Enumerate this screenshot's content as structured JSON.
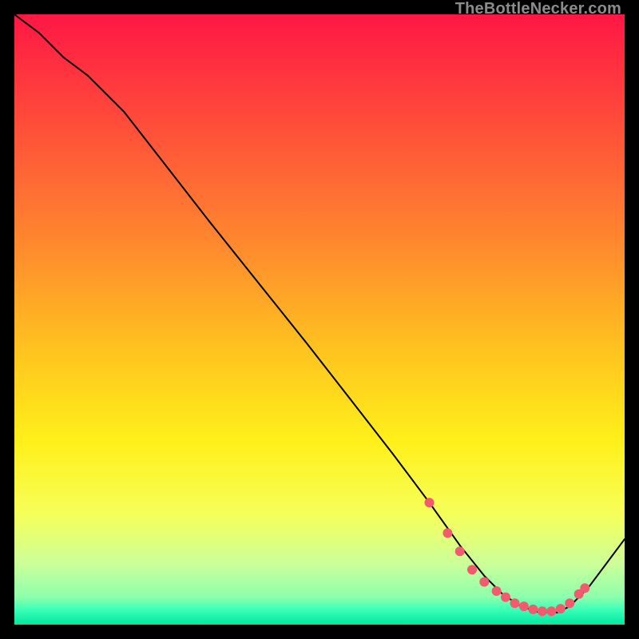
{
  "watermark": "TheBottleNecker.com",
  "chart_data": {
    "type": "line",
    "title": "",
    "xlabel": "",
    "ylabel": "",
    "xlim": [
      0,
      100
    ],
    "ylim": [
      0,
      100
    ],
    "background_gradient": {
      "stops": [
        {
          "offset": 0.0,
          "color": "#ff1744"
        },
        {
          "offset": 0.18,
          "color": "#ff4d3a"
        },
        {
          "offset": 0.38,
          "color": "#ff8a2e"
        },
        {
          "offset": 0.55,
          "color": "#ffc31f"
        },
        {
          "offset": 0.7,
          "color": "#fff01a"
        },
        {
          "offset": 0.82,
          "color": "#f6ff5a"
        },
        {
          "offset": 0.9,
          "color": "#ccff99"
        },
        {
          "offset": 0.955,
          "color": "#8dffac"
        },
        {
          "offset": 0.975,
          "color": "#3dffb7"
        },
        {
          "offset": 1.0,
          "color": "#00e8a0"
        }
      ]
    },
    "series": [
      {
        "name": "curve",
        "stroke": "#000000",
        "stroke_width": 2,
        "x": [
          0,
          4,
          8,
          12,
          18,
          25,
          32,
          40,
          48,
          55,
          62,
          68,
          73,
          77,
          80,
          83,
          86,
          89,
          91,
          94,
          97,
          100
        ],
        "y": [
          100,
          97,
          93,
          90,
          84,
          75,
          66,
          56,
          46,
          37,
          28,
          20,
          13,
          8,
          5,
          3,
          2,
          2,
          3,
          6,
          10,
          14
        ]
      }
    ],
    "markers": {
      "name": "valley-dots",
      "color": "#f25a6e",
      "radius": 6,
      "points": [
        {
          "x": 68,
          "y": 20
        },
        {
          "x": 71,
          "y": 15
        },
        {
          "x": 73,
          "y": 12
        },
        {
          "x": 75,
          "y": 9
        },
        {
          "x": 77,
          "y": 7
        },
        {
          "x": 79,
          "y": 5.5
        },
        {
          "x": 80.5,
          "y": 4.5
        },
        {
          "x": 82,
          "y": 3.5
        },
        {
          "x": 83.5,
          "y": 3
        },
        {
          "x": 85,
          "y": 2.5
        },
        {
          "x": 86.5,
          "y": 2.2
        },
        {
          "x": 88,
          "y": 2.2
        },
        {
          "x": 89.5,
          "y": 2.6
        },
        {
          "x": 91,
          "y": 3.5
        },
        {
          "x": 92.5,
          "y": 5
        },
        {
          "x": 93.5,
          "y": 6
        }
      ]
    }
  }
}
